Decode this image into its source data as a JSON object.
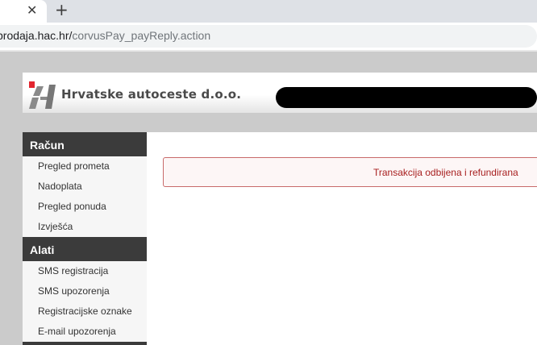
{
  "browser": {
    "close_tab_glyph": "✕",
    "new_tab_glyph": "+",
    "url_host": "prodaja.hac.hr/",
    "url_path": "corvusPay_payReply.action"
  },
  "header": {
    "company_name": "Hrvatske autoceste d.o.o.",
    "logo_colors": {
      "red": "#e3262f",
      "gray": "#777777"
    }
  },
  "sidebar": {
    "sections": [
      {
        "title": "Račun",
        "items": [
          "Pregled prometa",
          "Nadoplata",
          "Pregled ponuda",
          "Izvješća"
        ]
      },
      {
        "title": "Alati",
        "items": [
          "SMS registracija",
          "SMS upozorenja",
          "Registracijske oznake",
          "E-mail upozorenja"
        ]
      }
    ]
  },
  "alert": {
    "message": "Transakcija odbijena i refundirana",
    "color": "#a82020"
  }
}
